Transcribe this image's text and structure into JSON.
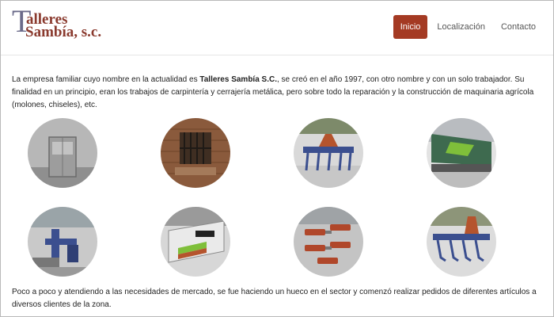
{
  "brand": {
    "logo_initial": "T",
    "logo_line1": "alleres",
    "logo_line2": "Sambía, s.c."
  },
  "nav": {
    "items": [
      "Inicio",
      "Localización",
      "Contacto"
    ],
    "active": "Inicio"
  },
  "intro": {
    "prefix": "La empresa familiar cuyo nombre en la actualidad es ",
    "company": "Talleres Sambía S.C.",
    "suffix": ", se creó en el año 1997, con otro nombre y con un solo trabajador. Su finalidad en un principio, eran los trabajos de carpintería y cerrajería metálica, pero sobre todo la reparación y la construcción de maquinaria agrícola (molones, chiseles), etc."
  },
  "gallery": {
    "photos": [
      "door-photo",
      "window-photo",
      "plough-photo",
      "press-photo",
      "machine-photo",
      "bender-photo",
      "parts-photo",
      "chisel-photo"
    ]
  },
  "outro": {
    "text": "Poco a poco y atendiendo a las necesidades de mercado, se fue haciendo un hueco en el sector y comenzó realizar pedidos de diferentes artículos a diversos clientes de la zona."
  },
  "colors": {
    "accent": "#a43a23",
    "logo_text": "#8a3a2e",
    "logo_initial": "#6b6b8a"
  }
}
